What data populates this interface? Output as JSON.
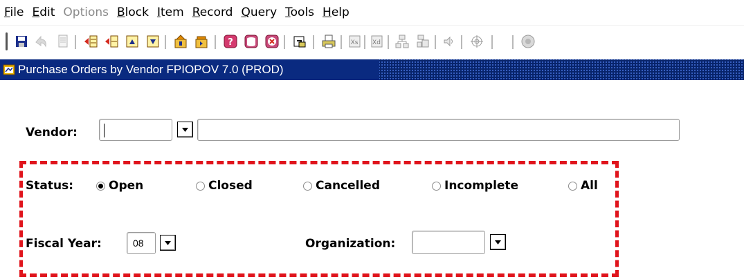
{
  "menu": {
    "items": [
      {
        "label": "File",
        "mnemonic": "F",
        "rest": "ile",
        "enabled": true
      },
      {
        "label": "Edit",
        "mnemonic": "E",
        "rest": "dit",
        "enabled": true
      },
      {
        "label": "Options",
        "mnemonic": "O",
        "rest": "ptions",
        "enabled": false
      },
      {
        "label": "Block",
        "mnemonic": "B",
        "rest": "lock",
        "enabled": true
      },
      {
        "label": "Item",
        "mnemonic": "I",
        "rest": "tem",
        "enabled": true
      },
      {
        "label": "Record",
        "mnemonic": "R",
        "rest": "ecord",
        "enabled": true
      },
      {
        "label": "Query",
        "mnemonic": "Q",
        "rest": "uery",
        "enabled": true
      },
      {
        "label": "Tools",
        "mnemonic": "T",
        "rest": "ools",
        "enabled": true
      },
      {
        "label": "Help",
        "mnemonic": "H",
        "rest": "elp",
        "enabled": true
      }
    ]
  },
  "toolbar": {
    "icons": [
      "save-icon",
      "rollback-icon",
      "print-page-icon",
      "insert-record-icon",
      "remove-record-icon",
      "block-previous-icon",
      "block-next-icon",
      "enter-query-icon",
      "execute-query-icon",
      "help-icon",
      "database-icon",
      "exit-icon",
      "options-icon",
      "print-icon",
      "extract-icon",
      "extract-data-icon",
      "network-icon",
      "move-icon",
      "sound-icon",
      "target-icon",
      "globe-icon"
    ]
  },
  "window": {
    "title": "Purchase Orders by Vendor  FPIOPOV  7.0  (PROD)"
  },
  "form": {
    "vendor": {
      "label": "Vendor:",
      "id_value": "",
      "name_value": ""
    },
    "status": {
      "label": "Status:",
      "options": [
        {
          "label": "Open",
          "checked": true
        },
        {
          "label": "Closed",
          "checked": false
        },
        {
          "label": "Cancelled",
          "checked": false
        },
        {
          "label": "Incomplete",
          "checked": false
        },
        {
          "label": "All",
          "checked": false
        }
      ]
    },
    "fiscal_year": {
      "label": "Fiscal Year:",
      "value": "08"
    },
    "organization": {
      "label": "Organization:",
      "value": ""
    }
  },
  "colors": {
    "title_bar": "#0a2a80",
    "highlight": "#e0141c"
  }
}
